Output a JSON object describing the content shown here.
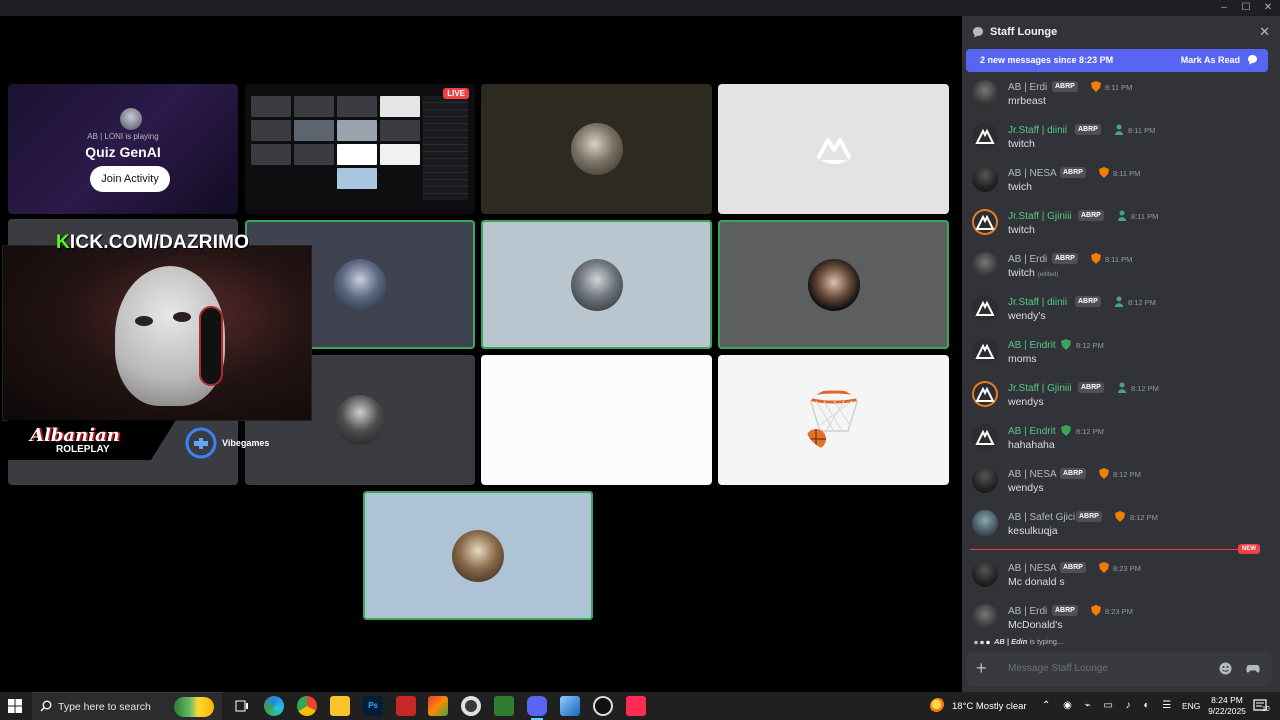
{
  "window": {
    "minimize": "–",
    "maximize": "☐",
    "close": "✕"
  },
  "activity": {
    "playing_text": "AB | LONI is playing",
    "game_title": "Quiz GenAI",
    "join_label": "Join Activity"
  },
  "screenshare": {
    "live_label": "LIVE"
  },
  "overlay": {
    "kick_k": "K",
    "kick_rest": "ICK.COM/DAZRIMO",
    "brand_name": "Albanian",
    "brand_sub": "ROLEPLAY",
    "partner": "Vibegames"
  },
  "chat": {
    "title": "Staff Lounge",
    "new_messages": "2 new messages since 8:23 PM",
    "mark_as_read": "Mark As Read",
    "new_label": "NEW",
    "messages": [
      {
        "author": "AB | Erdi",
        "tag": "ABRP",
        "time": "8:11 PM",
        "text": "mrbeast"
      },
      {
        "author": "Jr.Staff | diinii",
        "tag": "ABRP",
        "time": "8:11 PM",
        "text": "twitch"
      },
      {
        "author": "AB | NESA",
        "tag": "ABRP",
        "time": "8:11 PM",
        "text": "twich"
      },
      {
        "author": "Jr.Staff | Gjiniii",
        "tag": "ABRP",
        "time": "8:11 PM",
        "text": "twitch"
      },
      {
        "author": "AB | Erdi",
        "tag": "ABRP",
        "time": "8:11 PM",
        "text": "twitch",
        "edited": "(edited)"
      },
      {
        "author": "Jr.Staff | diinii",
        "tag": "ABRP",
        "time": "8:12 PM",
        "text": "wendy's"
      },
      {
        "author": "AB | Endrit",
        "time": "8:12 PM",
        "text": "moms"
      },
      {
        "author": "Jr.Staff | Gjiniii",
        "tag": "ABRP",
        "time": "8:12 PM",
        "text": "wendys"
      },
      {
        "author": "AB | Endrit",
        "time": "8:12 PM",
        "text": "hahahaha"
      },
      {
        "author": "AB | NESA",
        "tag": "ABRP",
        "time": "8:12 PM",
        "text": "wendys"
      },
      {
        "author": "AB | Safet Gjici",
        "tag": "ABRP",
        "time": "8:12 PM",
        "text": "kesulkuqja"
      },
      {
        "author": "AB | NESA",
        "tag": "ABRP",
        "time": "8:23 PM",
        "text": "Mc donald s"
      },
      {
        "author": "AB | Erdi",
        "tag": "ABRP",
        "time": "8:23 PM",
        "text": "McDonald's"
      }
    ],
    "typing_user": "AB | Edin",
    "typing_suffix": " is typing...",
    "composer_placeholder": "Message Staff Lounge"
  },
  "taskbar": {
    "search_placeholder": "Type here to search",
    "weather": "18°C  Mostly clear",
    "language": "ENG",
    "time": "8:24 PM",
    "date": "9/22/2025",
    "notification_count": "10"
  },
  "colors": {
    "discord_bg": "#313338",
    "blurple": "#5865f2",
    "speaking": "#3ba55c",
    "staff_green": "#57c78a",
    "new_red": "#f23f43",
    "kick_green": "#53fc18"
  }
}
